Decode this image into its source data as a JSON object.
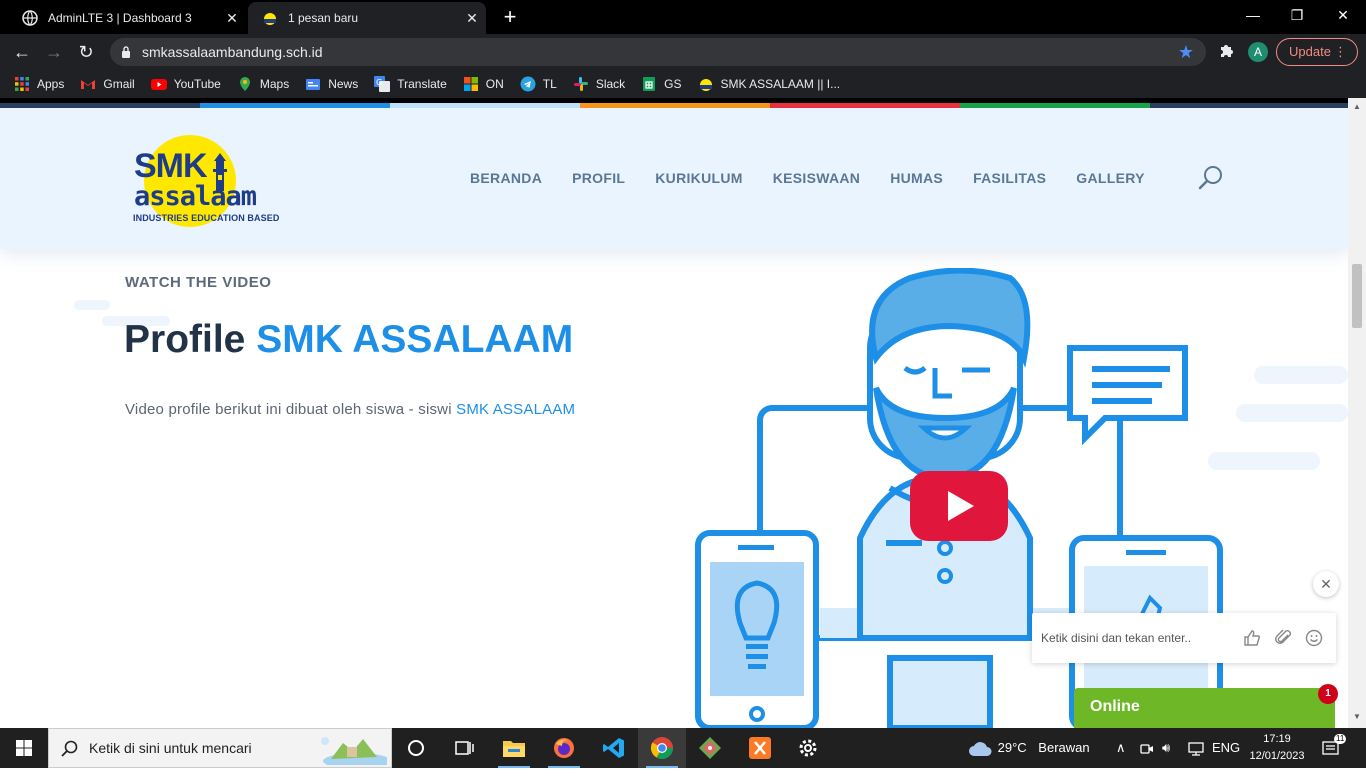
{
  "browser": {
    "tabs": [
      {
        "title": "AdminLTE 3 | Dashboard 3",
        "active": false
      },
      {
        "title": "1 pesan baru",
        "active": true
      }
    ],
    "url": "smkassalaambandung.sch.id",
    "profile_initial": "A",
    "update_label": "Update",
    "bookmarks": [
      {
        "label": "Apps",
        "icon": "apps-grid-icon"
      },
      {
        "label": "Gmail",
        "icon": "gmail-icon"
      },
      {
        "label": "YouTube",
        "icon": "youtube-icon"
      },
      {
        "label": "Maps",
        "icon": "maps-pin-icon"
      },
      {
        "label": "News",
        "icon": "news-icon"
      },
      {
        "label": "Translate",
        "icon": "translate-icon"
      },
      {
        "label": "ON",
        "icon": "microsoft-icon"
      },
      {
        "label": "TL",
        "icon": "telegram-icon"
      },
      {
        "label": "Slack",
        "icon": "slack-icon"
      },
      {
        "label": "GS",
        "icon": "google-sheets-icon"
      },
      {
        "label": "SMK ASSALAAM || I...",
        "icon": "site-favicon-icon"
      }
    ]
  },
  "site": {
    "logo": {
      "line1": "SMK",
      "line2": "assalaam",
      "tagline": "INDUSTRIES EDUCATION BASED"
    },
    "nav": [
      "BERANDA",
      "PROFIL",
      "KURIKULUM",
      "KESISWAAN",
      "HUMAS",
      "FASILITAS",
      "GALLERY"
    ],
    "eyebrow": "WATCH THE VIDEO",
    "headline_plain": "Profile ",
    "headline_accent": "SMK ASSALAAM",
    "lead_plain": "Video profile berikut ini dibuat oleh siswa - siswi ",
    "lead_accent": "SMK ASSALAAM"
  },
  "chat": {
    "placeholder": "Ketik disini dan tekan enter..",
    "status": "Online",
    "badge_count": "1"
  },
  "taskbar": {
    "search_placeholder": "Ketik di sini untuk mencari",
    "weather_temp": "29°C",
    "weather_text": "Berawan",
    "language": "ENG",
    "time": "17:19",
    "date": "12/01/2023",
    "notification_count": "11"
  },
  "colors": {
    "accent_blue": "#1e8fe6",
    "chat_green": "#6eb726",
    "youtube_red": "#e0163c",
    "header_bg": "#e9f4fe"
  }
}
